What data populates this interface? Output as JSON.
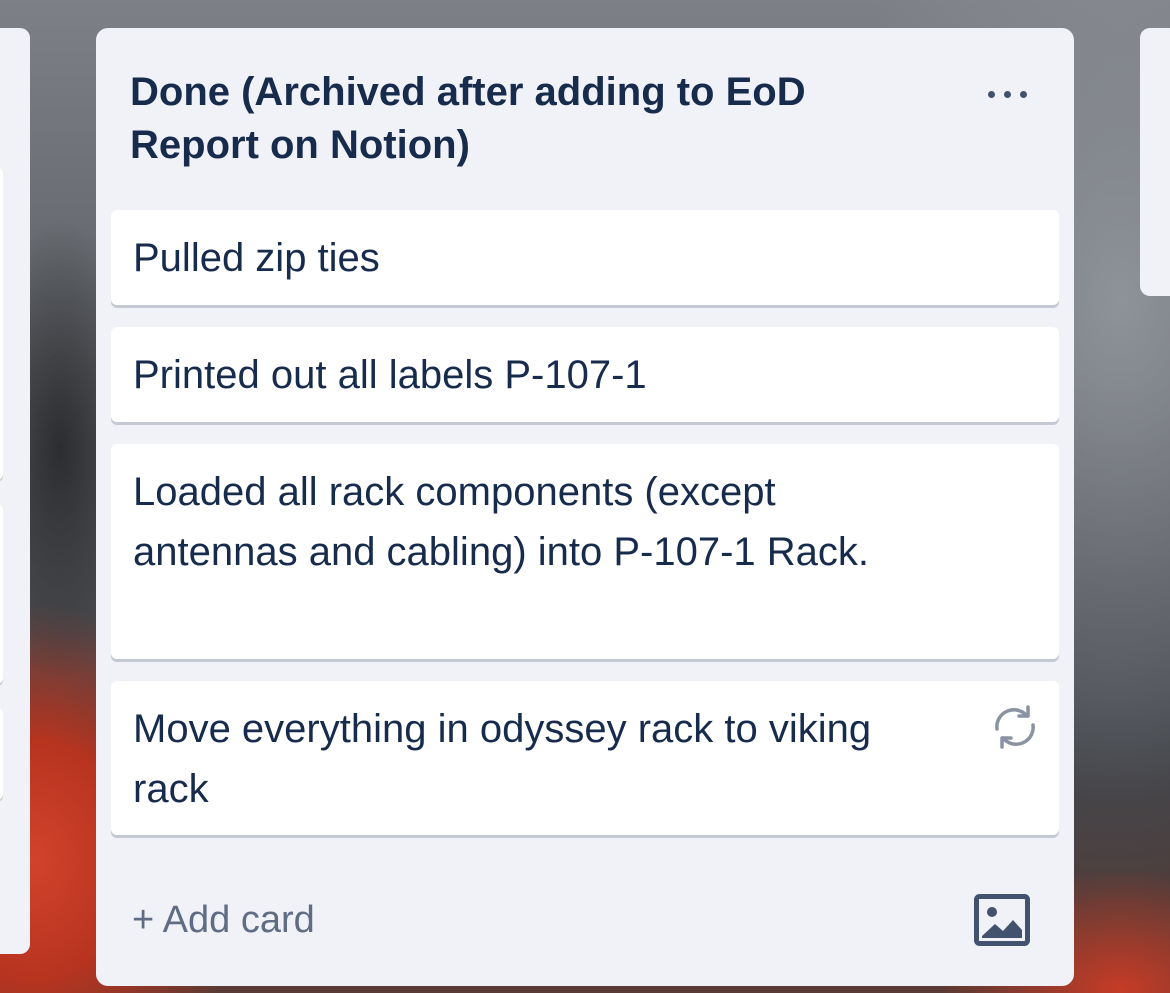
{
  "list": {
    "title": "Done (Archived after adding to EoD Report on Notion)",
    "menu_icon": "more-horizontal-icon",
    "cards": [
      {
        "text": "Pulled zip ties"
      },
      {
        "text": "Printed out all labels P-107-1"
      },
      {
        "text": "Loaded all rack components (except antennas and cabling) into P-107-1 Rack."
      },
      {
        "text": "Move everything in odyssey rack to viking rack",
        "badge_icon": "repeat-icon"
      }
    ],
    "add_card_label": "+ Add card",
    "template_icon": "image-template-icon"
  },
  "colors": {
    "list_bg": "#f1f2f7",
    "card_bg": "#ffffff",
    "title_text": "#172b4d",
    "muted_text": "#5e6c84",
    "icon": "#42526e"
  }
}
